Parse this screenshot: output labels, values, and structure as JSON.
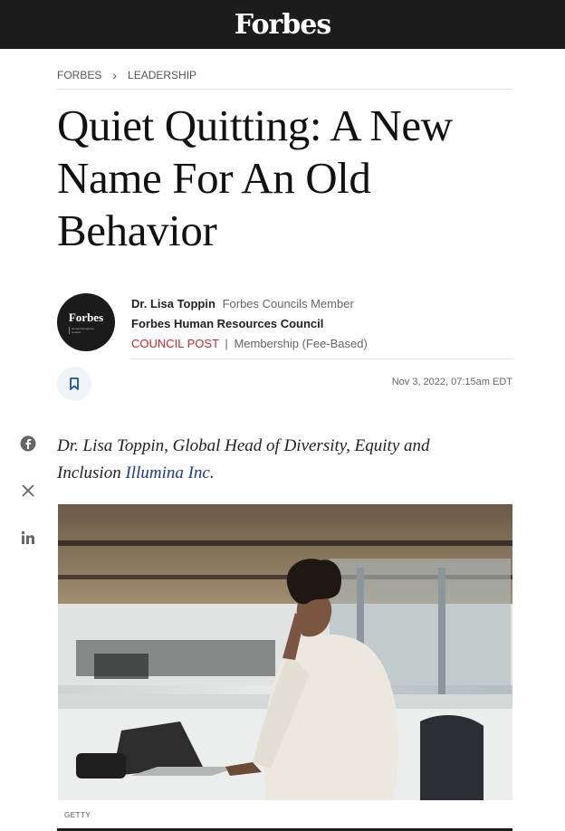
{
  "header": {
    "logo": "Forbes"
  },
  "breadcrumb": {
    "items": [
      "FORBES",
      "LEADERSHIP"
    ]
  },
  "article": {
    "title": "Quiet Quitting: A New Name For An Old Behavior",
    "author_name": "Dr. Lisa Toppin",
    "author_role": "Forbes Councils Member",
    "council": "Forbes Human Resources Council",
    "council_post": "COUNCIL POST",
    "separator": "|",
    "membership": "Membership (Fee-Based)",
    "date": "Nov 3, 2022, 07:15am EDT",
    "lead_text": "Dr. Lisa Toppin, Global Head of Diversity, Equity and Inclusion",
    "lead_link": "Illumina Inc",
    "lead_end": ".",
    "image_credit": "GETTY"
  },
  "avatar": {
    "logo": "Forbes",
    "sub": "Human Resources Council"
  },
  "share": {
    "icons": [
      "facebook-icon",
      "x-icon",
      "linkedin-icon"
    ]
  },
  "colors": {
    "topbar": "#1c1c1c",
    "council_post": "#cc2727",
    "link": "#1a3d8f"
  }
}
